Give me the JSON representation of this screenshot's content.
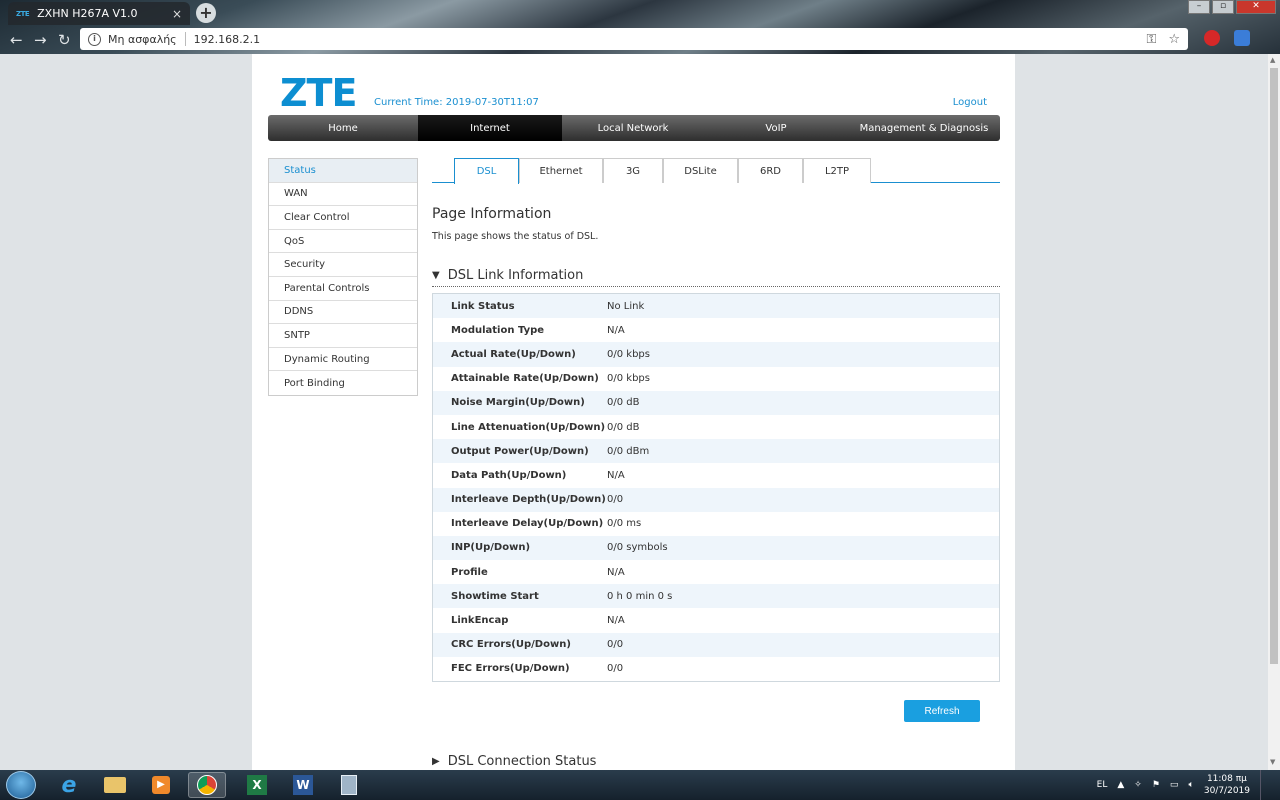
{
  "browser": {
    "tab_favicon": "ZTE",
    "tab_title": "ZXHN H267A V1.0",
    "tab_close": "×",
    "new_tab": "+",
    "security_label": "Μη ασφαλής",
    "url": "192.168.2.1",
    "icons": [
      "info-icon",
      "key-icon",
      "star-icon",
      "back-icon",
      "forward-icon",
      "reload-icon"
    ]
  },
  "header": {
    "logo": "ZTE",
    "current_time": "Current Time: 2019-07-30T11:07",
    "logout": "Logout"
  },
  "mainnav": [
    {
      "label": "Home",
      "active": false
    },
    {
      "label": "Internet",
      "active": true
    },
    {
      "label": "Local Network",
      "active": false
    },
    {
      "label": "VoIP",
      "active": false
    },
    {
      "label": "Management & Diagnosis",
      "active": false
    }
  ],
  "sidebar": [
    {
      "label": "Status",
      "active": true
    },
    {
      "label": "WAN"
    },
    {
      "label": "Clear Control"
    },
    {
      "label": "QoS"
    },
    {
      "label": "Security"
    },
    {
      "label": "Parental Controls"
    },
    {
      "label": "DDNS"
    },
    {
      "label": "SNTP"
    },
    {
      "label": "Dynamic Routing"
    },
    {
      "label": "Port Binding"
    }
  ],
  "subtabs": [
    {
      "label": "DSL",
      "active": true
    },
    {
      "label": "Ethernet"
    },
    {
      "label": "3G"
    },
    {
      "label": "DSLite"
    },
    {
      "label": "6RD"
    },
    {
      "label": "L2TP"
    }
  ],
  "page_info": {
    "title": "Page Information",
    "description": "This page shows the status of DSL."
  },
  "dsl_link": {
    "title": "DSL Link Information",
    "rows": [
      {
        "label": "Link Status",
        "value": "No Link"
      },
      {
        "label": "Modulation Type",
        "value": "N/A"
      },
      {
        "label": "Actual Rate(Up/Down)",
        "value": "0/0 kbps"
      },
      {
        "label": "Attainable Rate(Up/Down)",
        "value": "0/0 kbps"
      },
      {
        "label": "Noise Margin(Up/Down)",
        "value": "0/0 dB"
      },
      {
        "label": "Line Attenuation(Up/Down)",
        "value": "0/0 dB"
      },
      {
        "label": "Output Power(Up/Down)",
        "value": "0/0 dBm"
      },
      {
        "label": "Data Path(Up/Down)",
        "value": "N/A"
      },
      {
        "label": "Interleave Depth(Up/Down)",
        "value": "0/0"
      },
      {
        "label": "Interleave Delay(Up/Down)",
        "value": "0/0 ms"
      },
      {
        "label": "INP(Up/Down)",
        "value": "0/0 symbols"
      },
      {
        "label": "Profile",
        "value": "N/A"
      },
      {
        "label": "Showtime Start",
        "value": "0 h 0 min 0 s"
      },
      {
        "label": "LinkEncap",
        "value": "N/A"
      },
      {
        "label": "CRC Errors(Up/Down)",
        "value": "0/0"
      },
      {
        "label": "FEC Errors(Up/Down)",
        "value": "0/0"
      }
    ],
    "refresh": "Refresh"
  },
  "dsl_connection": {
    "title": "DSL Connection Status"
  },
  "taskbar": {
    "language": "EL",
    "time": "11:08 πμ",
    "date": "30/7/2019",
    "apps": [
      "ie-icon",
      "explorer-icon",
      "media-player-icon",
      "chrome-icon",
      "excel-icon",
      "word-icon",
      "calculator-icon"
    ],
    "excel_letter": "X",
    "word_letter": "W"
  }
}
